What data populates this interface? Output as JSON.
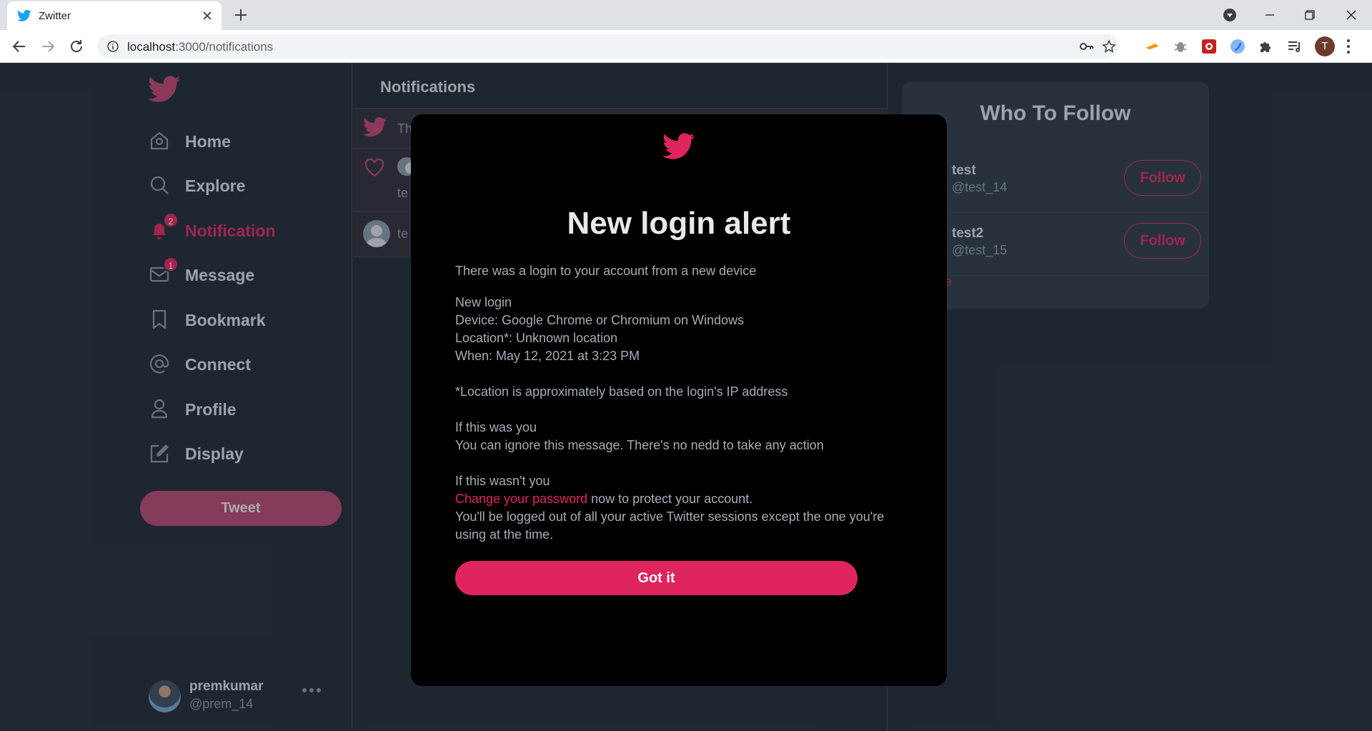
{
  "browser": {
    "tab_title": "Zwitter",
    "url_host": "localhost",
    "url_rest": ":3000/notifications",
    "profile_initial": "T"
  },
  "sidebar": {
    "items": [
      {
        "label": "Home",
        "icon": "home-icon"
      },
      {
        "label": "Explore",
        "icon": "search-icon"
      },
      {
        "label": "Notification",
        "icon": "bell-icon",
        "badge": "2"
      },
      {
        "label": "Message",
        "icon": "mail-icon",
        "badge": "1"
      },
      {
        "label": "Bookmark",
        "icon": "bookmark-icon"
      },
      {
        "label": "Connect",
        "icon": "at-icon"
      },
      {
        "label": "Profile",
        "icon": "user-icon"
      },
      {
        "label": "Display",
        "icon": "edit-icon"
      }
    ],
    "tweet_label": "Tweet",
    "user": {
      "name": "premkumar",
      "handle": "@prem_14"
    }
  },
  "main": {
    "title": "Notifications",
    "notifications": [
      {
        "text": "Th"
      },
      {
        "text": "te"
      },
      {
        "text": "te"
      }
    ]
  },
  "right": {
    "title": "Who To Follow",
    "suggestions": [
      {
        "name": "test",
        "handle": "@test_14",
        "button": "Follow"
      },
      {
        "name": "test2",
        "handle": "@test_15",
        "button": "Follow"
      }
    ],
    "show_more": "e"
  },
  "modal": {
    "title": "New login alert",
    "intro": "There was a login to your account from a new device",
    "details": [
      "New login",
      "Device: Google Chrome or Chromium on Windows",
      "Location*: Unknown location",
      "When: May 12, 2021 at 3:23 PM"
    ],
    "location_note": "*Location is approximately based on the login's IP address",
    "was_you_heading": "If this was you",
    "was_you_text": "You can ignore this message. There's no nedd to take any action",
    "not_you_heading": "If this wasn't you",
    "change_password_link": "Change your password",
    "change_password_rest": " now to protect your account.",
    "logout_note": "You'll be logged out of all your active Twitter sessions except the one you're using at the time.",
    "button_label": "Got it"
  },
  "colors": {
    "accent": "#e0245e",
    "background": "#1e2732",
    "modal": "#000000"
  }
}
